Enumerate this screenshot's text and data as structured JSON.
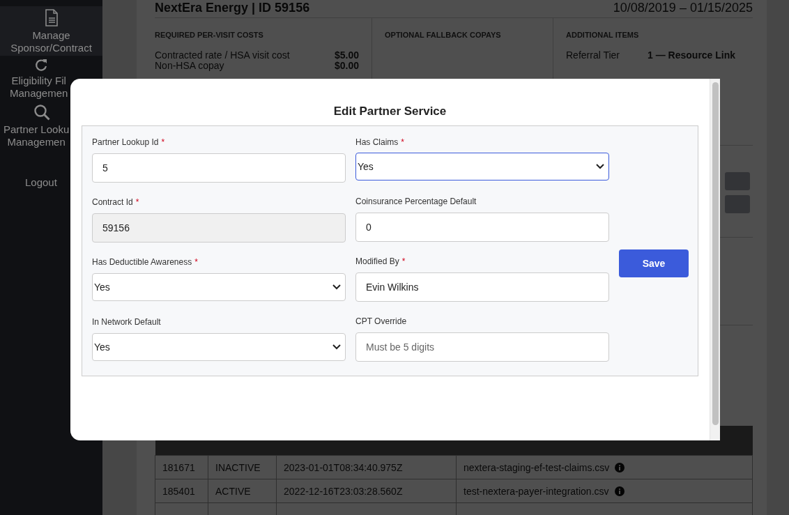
{
  "sidebar": {
    "items": [
      {
        "lines": [
          "Manage",
          "Sponsor/Contract"
        ],
        "selected": true
      },
      {
        "lines": [
          "Eligibility Fil",
          "Managemen"
        ],
        "selected": false
      },
      {
        "lines": [
          "Partner Looku",
          "Managemen"
        ],
        "selected": false
      },
      {
        "lines": [
          "Logout"
        ],
        "selected": false
      }
    ]
  },
  "page": {
    "title": "NextEra Energy | ID 59156",
    "dates": "10/08/2019 – 01/15/2025",
    "sections": [
      {
        "heading": "REQUIRED PER-VISIT COSTS",
        "rows": [
          {
            "label": "Contracted rate / HSA visit cost",
            "value": "$5.00"
          },
          {
            "label": "Non-HSA copay",
            "value": "$0.00"
          }
        ]
      },
      {
        "heading": "OPTIONAL FALLBACK COPAYS"
      },
      {
        "heading": "ADDITIONAL ITEMS",
        "rows": [
          {
            "label": "Referral Tier",
            "value": "1 — Resource Link"
          }
        ]
      }
    ],
    "files_table": {
      "rows": [
        {
          "cells": [
            "181671",
            "INACTIVE",
            "2023-01-01T08:34:40.975Z",
            "nextera-staging-ef-test-claims.csv"
          ]
        },
        {
          "cells": [
            "185401",
            "ACTIVE",
            "2022-12-16T23:03:28.560Z",
            "test-nextera-payer-integration.csv"
          ]
        }
      ]
    }
  },
  "modal": {
    "title": "Edit Partner Service",
    "columns": [
      [
        {
          "label": "Partner Lookup Id",
          "required_mark": "*",
          "kind": "input",
          "value": "5",
          "focused": false
        },
        {
          "label": "Contract Id",
          "required_mark": "*",
          "kind": "readonly",
          "value": "59156",
          "focused": false
        },
        {
          "label": "Has Deductible Awareness",
          "required_mark": "*",
          "kind": "select",
          "value": "Yes",
          "focused": false
        },
        {
          "label": "In Network Default",
          "kind": "select",
          "value": "Yes",
          "focused": false
        }
      ],
      [
        {
          "label": "Has Claims",
          "required_mark": "*",
          "kind": "select",
          "value": "Yes",
          "focused": true
        },
        {
          "label": "Coinsurance Percentage Default",
          "kind": "input",
          "value": "0",
          "focused": false
        },
        {
          "label": "Modified By",
          "required_mark": "*",
          "kind": "input",
          "value": "Evin Wilkins",
          "focused": false
        },
        {
          "label": "CPT Override",
          "kind": "input",
          "placeholder": "Must be 5 digits",
          "focused": false
        }
      ]
    ],
    "save_button": "Save"
  }
}
